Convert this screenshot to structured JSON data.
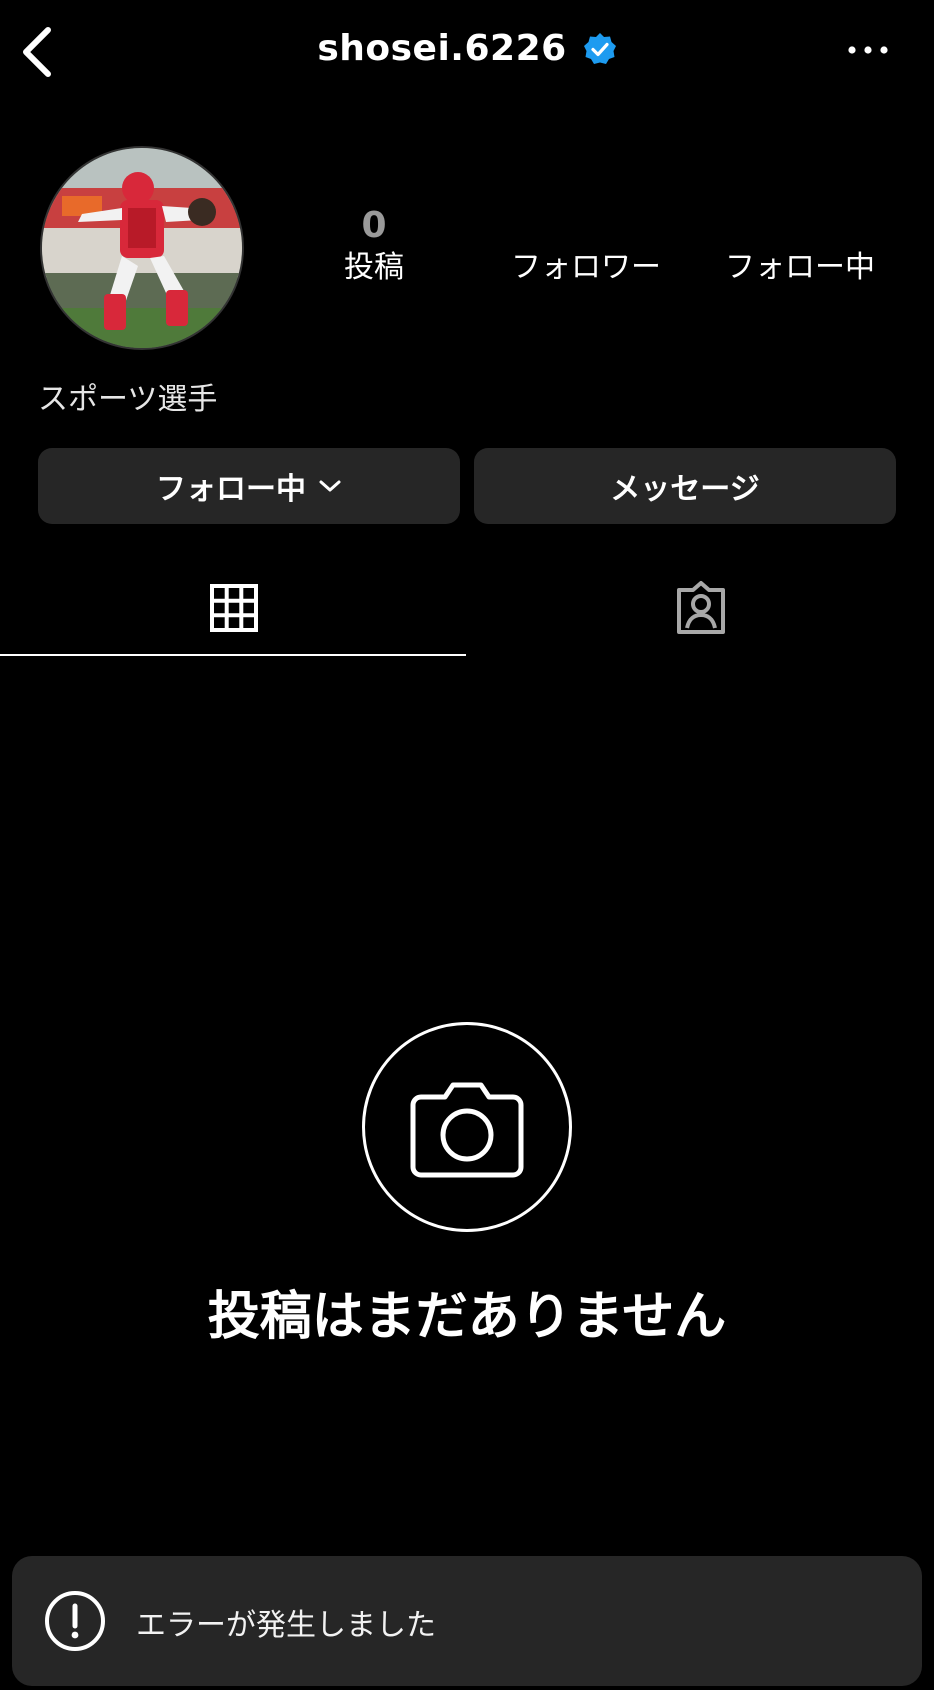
{
  "header": {
    "username": "shosei.6226",
    "verified": true,
    "back_icon": "chevron-left-icon",
    "more_icon": "more-dots-icon"
  },
  "profile": {
    "avatar_alt": "profile photo",
    "stats": {
      "posts_count": "0",
      "posts_label": "投稿",
      "followers_label": "フォロワー",
      "following_label": "フォロー中"
    },
    "category": "スポーツ選手"
  },
  "actions": {
    "following_label": "フォロー中",
    "message_label": "メッセージ"
  },
  "tabs": [
    {
      "name": "grid",
      "icon": "grid-icon",
      "active": true
    },
    {
      "name": "tagged",
      "icon": "tagged-person-icon",
      "active": false
    }
  ],
  "empty_state": {
    "icon": "camera-icon",
    "text": "投稿はまだありません"
  },
  "toast": {
    "icon": "exclamation-circle-icon",
    "text": "エラーが発生しました"
  },
  "colors": {
    "background": "#000000",
    "button_bg": "#262626",
    "verified_blue": "#1D9BF0",
    "muted_count": "#9a9a9a"
  }
}
